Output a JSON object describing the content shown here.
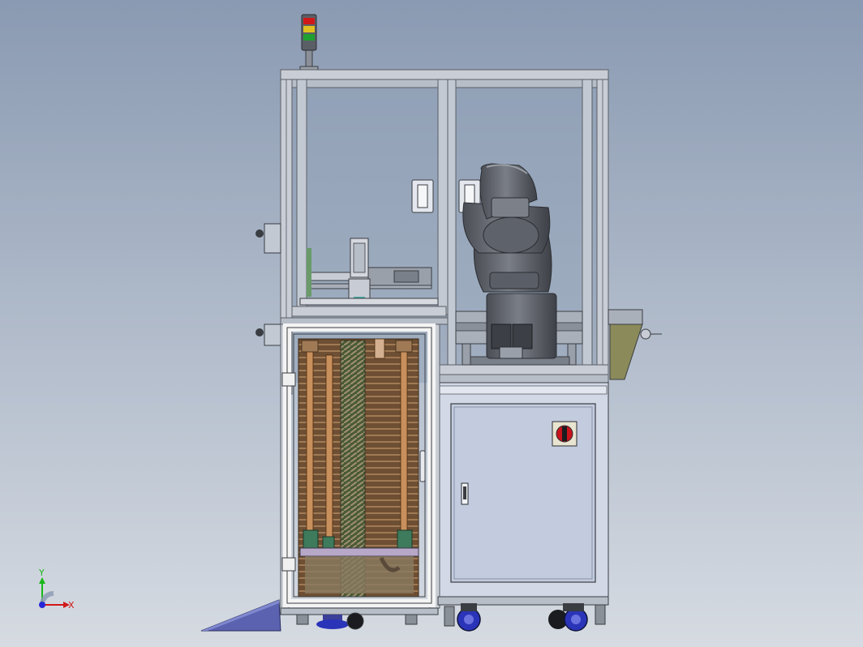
{
  "viewport": {
    "background_top": "#8a9ab2",
    "background_bottom": "#d6dbe2"
  },
  "colors": {
    "frame": "#c9ced6",
    "frame_dark": "#5a5f66",
    "glass": "#8fa0b6",
    "cabinet": "#d2d8e6",
    "cabinet_panel": "#c3cbde",
    "robot": "#6c7078",
    "robot_dark": "#3c3f45",
    "wood": "#7a5a3c",
    "copper": "#c8905c",
    "green": "#3e7a5c",
    "ramp": "#5b63b0",
    "wheel": "#2a34b8",
    "beacon_red": "#d01818",
    "beacon_yellow": "#e0c020",
    "beacon_green": "#20a030",
    "estop_red": "#c8141c",
    "axis_y": "#18b818",
    "axis_x": "#d01818",
    "axis_z": "#2828d8"
  },
  "icons": {
    "triad": "coordinate-triad-icon",
    "beacon": "signal-tower-icon",
    "estop": "emergency-stop-icon"
  },
  "triad": {
    "y_label": "Y",
    "x_label": "X"
  }
}
